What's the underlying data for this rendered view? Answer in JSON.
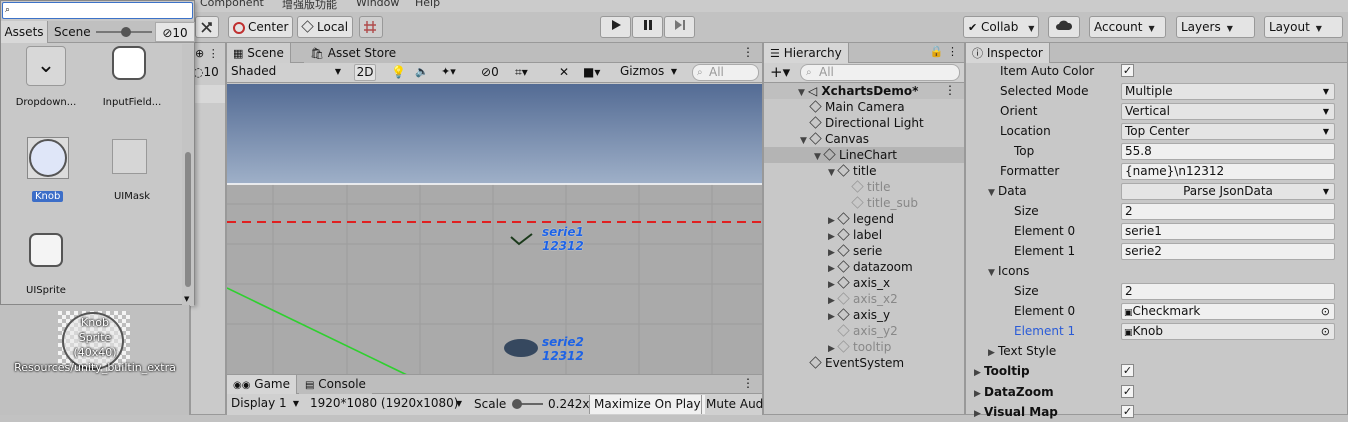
{
  "menu": {
    "items": [
      "Component",
      "增强版功能",
      "Window",
      "Help"
    ]
  },
  "toolbar": {
    "pivot": "Center",
    "space": "Local",
    "collab": "Collab",
    "account": "Account",
    "layers": "Layers",
    "layout": "Layout"
  },
  "object_picker": {
    "search_value": "",
    "tabs": [
      "Assets",
      "Scene"
    ],
    "hidden_count": "10",
    "items": [
      {
        "label": "Dropdown..."
      },
      {
        "label": "InputField..."
      },
      {
        "label": "Knob"
      },
      {
        "label": "UIMask"
      },
      {
        "label": "UISprite"
      }
    ],
    "preview": {
      "name": "Knob",
      "type": "Sprite",
      "size": "(40x40)",
      "path": "Resources/unity_builtin_extra"
    }
  },
  "left_strip": {
    "hidden_count": "10"
  },
  "scene": {
    "tabs": [
      "Scene",
      "Asset Store"
    ],
    "shading": "Shaded",
    "mode_2d": "2D",
    "hidden_count": "0",
    "gizmos": "Gizmos",
    "search_placeholder": "All",
    "serie1_label": "serie1",
    "serie1_value": "12312",
    "serie2_label": "serie2",
    "serie2_value": "12312"
  },
  "game": {
    "tabs": [
      "Game",
      "Console"
    ],
    "display": "Display 1",
    "resolution": "1920*1080 (1920x1080)",
    "scale_label": "Scale",
    "scale_value": "0.242x",
    "maximize": "Maximize On Play",
    "mute": "Mute Audi"
  },
  "hierarchy": {
    "title": "Hierarchy",
    "search_placeholder": "All",
    "scene_name": "XchartsDemo*",
    "nodes": [
      {
        "label": "Main Camera"
      },
      {
        "label": "Directional Light"
      },
      {
        "label": "Canvas"
      },
      {
        "label": "LineChart"
      },
      {
        "label": "title"
      },
      {
        "label": "title"
      },
      {
        "label": "title_sub"
      },
      {
        "label": "legend"
      },
      {
        "label": "label"
      },
      {
        "label": "serie"
      },
      {
        "label": "datazoom"
      },
      {
        "label": "axis_x"
      },
      {
        "label": "axis_x2"
      },
      {
        "label": "axis_y"
      },
      {
        "label": "axis_y2"
      },
      {
        "label": "tooltip"
      },
      {
        "label": "EventSystem"
      }
    ]
  },
  "inspector": {
    "title": "Inspector",
    "item_auto_color": "Item Auto Color",
    "selected_mode_label": "Selected Mode",
    "selected_mode": "Multiple",
    "orient_label": "Orient",
    "orient": "Vertical",
    "location_label": "Location",
    "location": "Top Center",
    "top_label": "Top",
    "top": "55.8",
    "formatter_label": "Formatter",
    "formatter": "{name}\\n12312",
    "data_label": "Data",
    "parse_button": "Parse JsonData",
    "data_size_label": "Size",
    "data_size": "2",
    "data_e0_label": "Element 0",
    "data_e0": "serie1",
    "data_e1_label": "Element 1",
    "data_e1": "serie2",
    "icons_label": "Icons",
    "icons_size_label": "Size",
    "icons_size": "2",
    "icons_e0_label": "Element 0",
    "icons_e0": "Checkmark",
    "icons_e1_label": "Element 1",
    "icons_e1": "Knob",
    "text_style": "Text Style",
    "tooltip": "Tooltip",
    "datazoom": "DataZoom",
    "visualmap": "Visual Map",
    "accent": "#2a5bd7"
  }
}
